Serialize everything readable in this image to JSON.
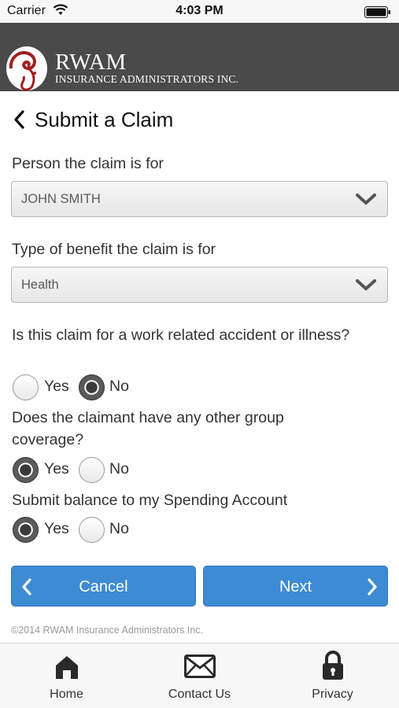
{
  "status_bar": {
    "carrier": "Carrier",
    "time": "4:03 PM",
    "wifi_icon": "wifi-icon",
    "battery_icon": "battery-icon"
  },
  "brand": {
    "name": "RWAM",
    "subtitle": "INSURANCE ADMINISTRATORS INC.",
    "logo_icon": "ram-logo-icon",
    "header_color": "#4a4a4a"
  },
  "page": {
    "title": "Submit a Claim",
    "back_icon": "chevron-left-icon"
  },
  "form": {
    "person": {
      "label": "Person the claim is for",
      "value": "JOHN SMITH"
    },
    "benefit": {
      "label": "Type of benefit the claim is for",
      "value": "Health"
    },
    "work_related": {
      "question": "Is this claim for a work related accident or illness?",
      "options": [
        "Yes",
        "No"
      ],
      "selected": "No"
    },
    "other_coverage": {
      "question": "Does the claimant have any other group coverage?",
      "options": [
        "Yes",
        "No"
      ],
      "selected": "Yes"
    },
    "spending_account": {
      "question": "Submit balance to my Spending Account",
      "options": [
        "Yes",
        "No"
      ],
      "selected": "Yes"
    }
  },
  "actions": {
    "cancel_label": "Cancel",
    "next_label": "Next",
    "accent": "#3d8bd3"
  },
  "footer": {
    "copyright": "©2014 RWAM Insurance Administrators Inc."
  },
  "tabs": [
    {
      "label": "Home",
      "icon": "home-icon"
    },
    {
      "label": "Contact Us",
      "icon": "envelope-icon"
    },
    {
      "label": "Privacy",
      "icon": "lock-icon"
    }
  ]
}
